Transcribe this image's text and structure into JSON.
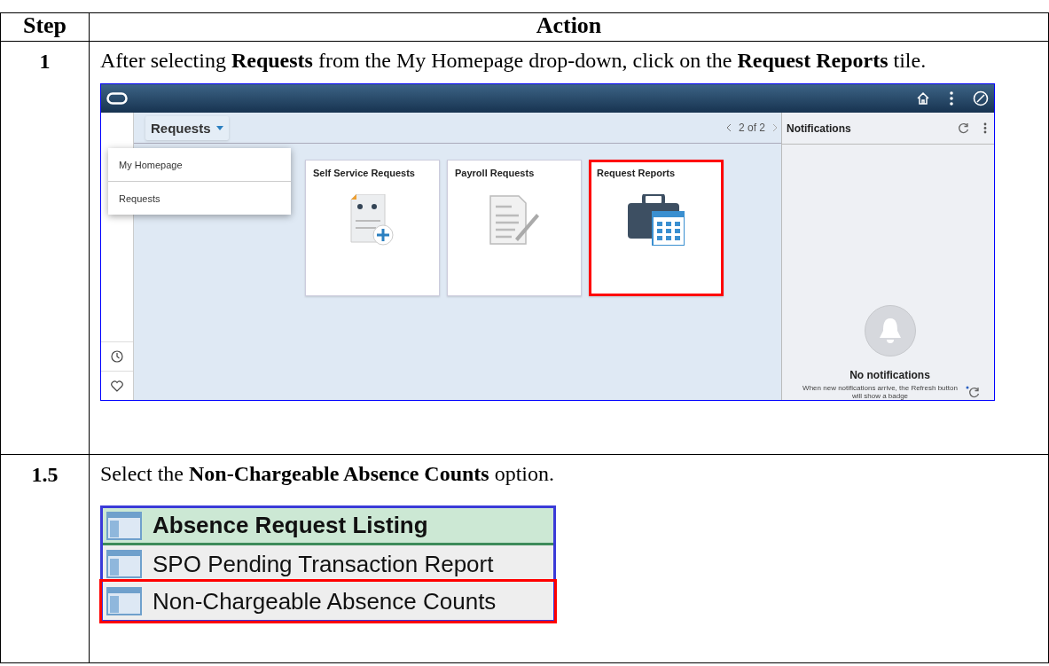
{
  "table": {
    "columns": [
      "Step",
      "Action"
    ],
    "rows": [
      {
        "step": "1",
        "instruction": "After selecting **Requests** from the My Homepage drop-down, click on the **Request Reports** tile.",
        "screenshot": {
          "kind": "homepage",
          "page_title": "Requests",
          "menu": [
            "My Homepage",
            "Requests"
          ],
          "pager": "2 of 2",
          "tiles": [
            {
              "title": "Self Service Requests",
              "highlighted": false
            },
            {
              "title": "Payroll Requests",
              "highlighted": false
            },
            {
              "title": "Request Reports",
              "highlighted": true
            }
          ],
          "notifications": {
            "title": "Notifications",
            "empty_title": "No notifications",
            "empty_text": "When new notifications arrive, the Refresh button will show a badge"
          }
        }
      },
      {
        "step": "1.5",
        "instruction": "Select the **Non-Chargeable Absence Counts** option.",
        "screenshot": {
          "kind": "list",
          "items": [
            {
              "label": "Absence Request Listing",
              "kind": "header",
              "highlighted": false
            },
            {
              "label": "SPO Pending Transaction Report",
              "kind": "item",
              "highlighted": false
            },
            {
              "label": "Non-Chargeable Absence Counts",
              "kind": "item",
              "highlighted": true
            }
          ]
        }
      }
    ]
  }
}
